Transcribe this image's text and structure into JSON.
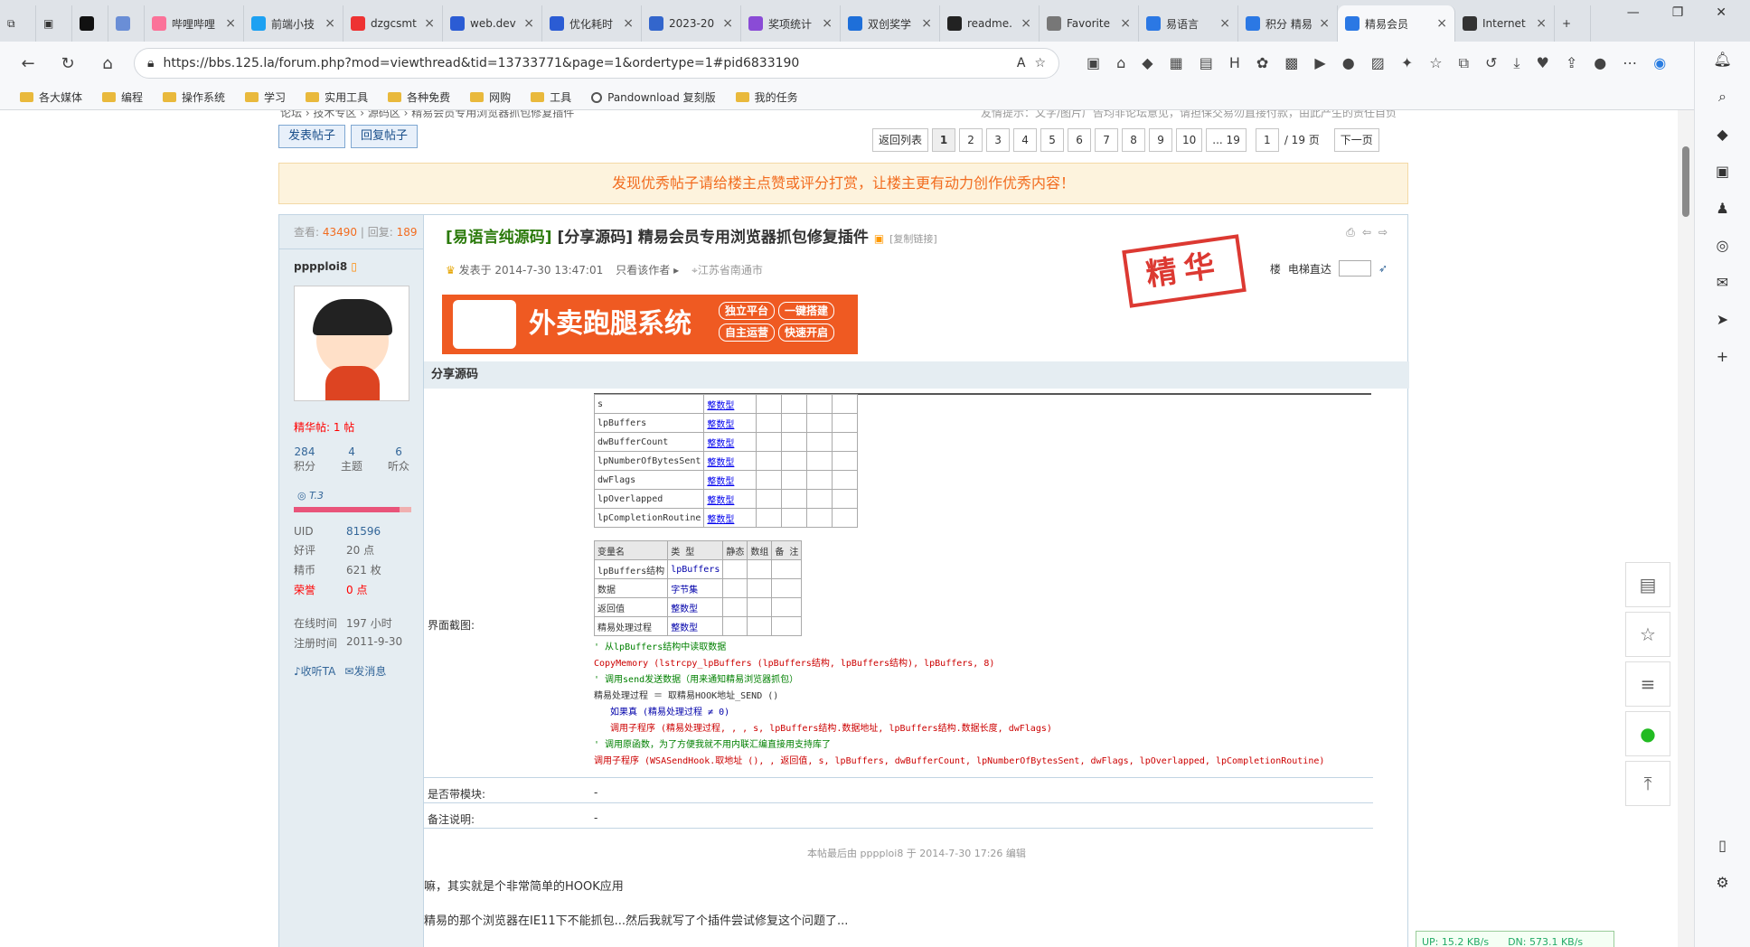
{
  "tabs": [
    {
      "label": "哔哩哔哩",
      "color": "#fb7299"
    },
    {
      "label": "前端小技",
      "color": "#1da1f2"
    },
    {
      "label": "dzgcsmt",
      "color": "#e33"
    },
    {
      "label": "web.dev",
      "color": "#2b5cd4"
    },
    {
      "label": "优化耗时",
      "color": "#2b5cd4"
    },
    {
      "label": "2023-20",
      "color": "#3366cc"
    },
    {
      "label": "奖项统计",
      "color": "#8a4bd6"
    },
    {
      "label": "双创奖学",
      "color": "#1e6fd9"
    },
    {
      "label": "readme.",
      "color": "#222"
    },
    {
      "label": "Favorite",
      "color": "#777"
    },
    {
      "label": "易语言",
      "color": "#2b78e4"
    },
    {
      "label": "积分 精易",
      "color": "#2b78e4"
    },
    {
      "label": "精易会员",
      "color": "#2b78e4"
    },
    {
      "label": "Internet",
      "color": "#333"
    }
  ],
  "url": "https://bbs.125.la/forum.php?mod=viewthread&tid=13733771&page=1&ordertype=1#pid6833190",
  "bookmarks": [
    "各大媒体",
    "编程",
    "操作系统",
    "学习",
    "实用工具",
    "各种免费",
    "网购",
    "工具",
    "Pandownload 复刻版",
    "我的任务"
  ],
  "breadcrumb": "论坛 › 技术专区 › 源码区 › 精易会员专用浏览器抓包修复插件",
  "tip": "友情提示：文字/图片广告均非论坛意见，请担保交易勿直接付款，由此产生的责任自负",
  "buttons": {
    "new_post": "发表帖子",
    "reply": "回复帖子"
  },
  "pager": {
    "back": "返回列表",
    "pages": [
      "1",
      "2",
      "3",
      "4",
      "5",
      "6",
      "7",
      "8",
      "9",
      "10",
      "... 19"
    ],
    "input": "1",
    "total": "/ 19 页",
    "next": "下一页"
  },
  "notice": "发现优秀帖子请给楼主点赞或评分打赏，让楼主更有动力创作优秀内容！",
  "stats": {
    "views_label": "查看:",
    "views": "43490",
    "replies_label": "回复:",
    "replies": "189"
  },
  "user": {
    "name": "pppploi8",
    "essence": "精华帖: 1 帖",
    "points": "284",
    "points_label": "积分",
    "topics": "4",
    "topics_label": "主题",
    "fans": "6",
    "fans_label": "听众",
    "level": "T.3",
    "uid_label": "UID",
    "uid": "81596",
    "good_label": "好评",
    "good": "20 点",
    "coin_label": "精币",
    "coin": "621 枚",
    "honor_label": "荣誉",
    "honor": "0 点",
    "online_label": "在线时间",
    "online": "197 小时",
    "reg_label": "注册时间",
    "reg": "2011-9-30",
    "collect": "收听TA",
    "msg": "发消息"
  },
  "post": {
    "category": "[易语言纯源码]",
    "title": "[分享源码] 精易会员专用浏览器抓包修复插件",
    "copy_link": "[复制链接]",
    "time": "发表于 2014-7-30 13:47:01",
    "only_author": "只看该作者",
    "location": "江苏省南通市",
    "floor": "楼",
    "elevator": "电梯直达",
    "stamp": "精华",
    "ad": "外卖跑腿系统",
    "ad_tags": [
      "独立平台",
      "一键搭建",
      "自主运营",
      "快速开启"
    ],
    "section": "分享源码",
    "screenshot_label": "界面截图:",
    "module_label": "是否带模块:",
    "module_value": "-",
    "remark_label": "备注说明:",
    "remark_value": "-",
    "edited": "本帖最后由 pppploi8 于 2014-7-30 17:26 编辑",
    "text1": "嘛，其实就是个非常简单的HOOK应用",
    "text2": "精易的那个浏览器在IE11下不能抓包...然后我就写了个插件尝试修复这个问题了..."
  },
  "code_table1": [
    [
      "s",
      "整数型"
    ],
    [
      "lpBuffers",
      "整数型"
    ],
    [
      "dwBufferCount",
      "整数型"
    ],
    [
      "lpNumberOfBytesSent",
      "整数型"
    ],
    [
      "dwFlags",
      "整数型"
    ],
    [
      "lpOverlapped",
      "整数型"
    ],
    [
      "lpCompletionRoutine",
      "整数型"
    ]
  ],
  "code_table2_header": [
    "变量名",
    "类 型",
    "静态",
    "数组",
    "备 注"
  ],
  "code_table2": [
    [
      "lpBuffers结构",
      "lpBuffers"
    ],
    [
      "数据",
      "字节集"
    ],
    [
      "返回值",
      "整数型"
    ],
    [
      "精易处理过程",
      "整数型"
    ]
  ],
  "code_lines": [
    "' 从lpBuffers结构中读取数据",
    "CopyMemory (lstrcpy_lpBuffers (lpBuffers结构, lpBuffers结构), lpBuffers, 8)",
    "' 调用send发送数据（用来通知精易浏览器抓包）",
    "精易处理过程 ＝ 取精易HOOK地址_SEND ()",
    "如果真 (精易处理过程 ≠ 0)",
    "调用子程序 (精易处理过程, , , s, lpBuffers结构.数据地址, lpBuffers结构.数据长度, dwFlags)",
    "' 调用原函数，为了方便我就不用内联汇编直接用支持库了",
    "调用子程序 (WSASendHook.取地址 (), , 返回值, s, lpBuffers, dwBufferCount, lpNumberOfBytesSent, dwFlags, lpOverlapped, lpCompletionRoutine)"
  ],
  "net": {
    "up": "UP: 15.2 KB/s",
    "down": "DN: 573.1 KB/s"
  }
}
